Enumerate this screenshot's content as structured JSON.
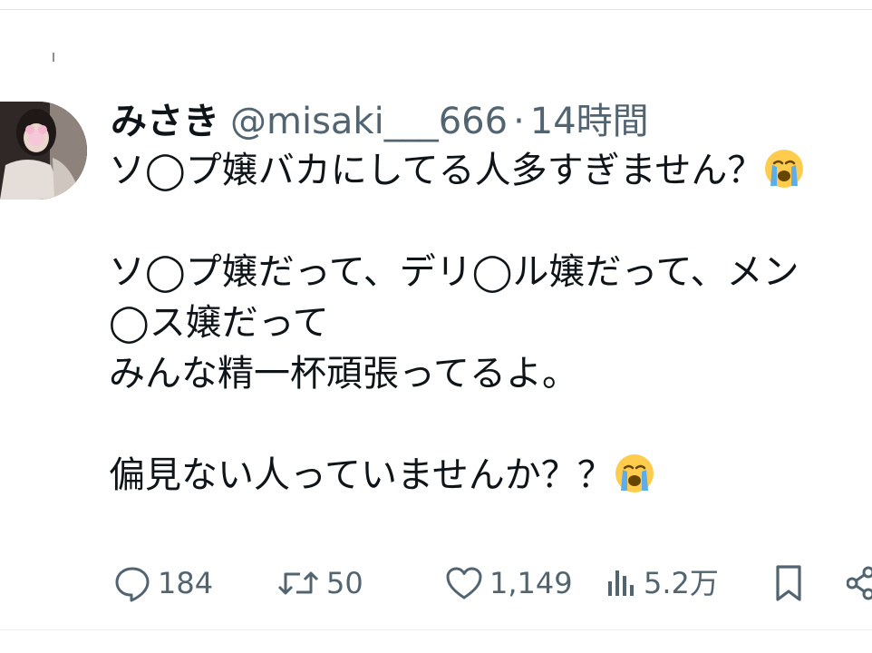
{
  "tweet": {
    "display_name": "みさき",
    "handle": "@misaki___666",
    "separator": "·",
    "time": "14時間",
    "lines": [
      "ソ◯プ嬢バカにしてる人多すぎません？",
      "",
      "ソ◯プ嬢だって、デリ◯ル嬢だって、メン",
      "◯ス嬢だって",
      "みんな精一杯頑張ってるよ。",
      "",
      "偏見ない人っていませんか？？"
    ],
    "emoji": [
      "loudly-crying-face",
      "loudly-crying-face"
    ]
  },
  "actions": {
    "replies": "184",
    "retweets": "50",
    "likes": "1,149",
    "views": "5.2万"
  },
  "colors": {
    "text": "#0f1419",
    "secondary": "#536471",
    "divider": "#e6e6e6"
  }
}
